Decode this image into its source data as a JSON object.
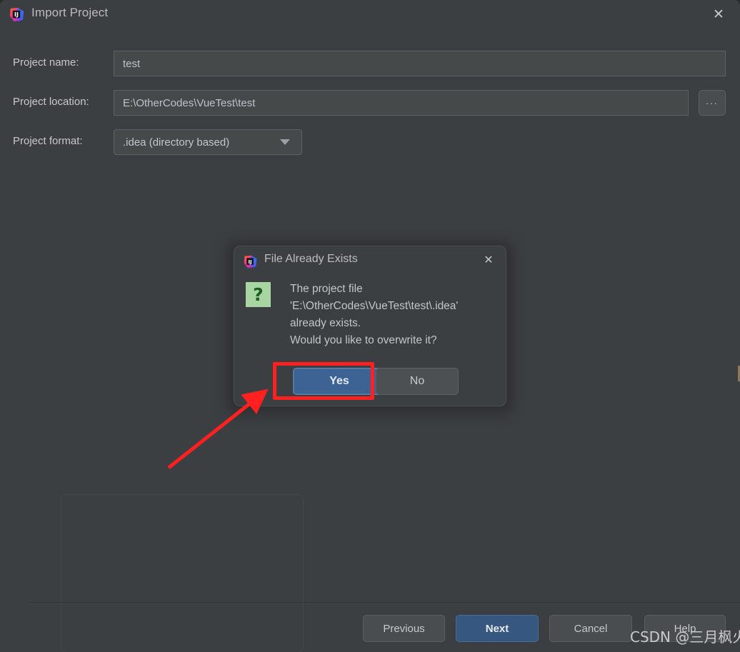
{
  "window": {
    "title": "Import Project",
    "logo_icon": "intellij-idea-logo",
    "close_icon": "close-icon"
  },
  "form": {
    "rows": [
      {
        "label": "Project name:",
        "value": "test"
      },
      {
        "label": "Project location:",
        "value": "E:\\OtherCodes\\VueTest\\test"
      },
      {
        "label": "Project format:",
        "value": ".idea (directory based)"
      }
    ],
    "browse_icon": "ellipsis-icon",
    "browse_label": "...",
    "caret_icon": "chevron-down-icon"
  },
  "footer": {
    "buttons": [
      {
        "label": "Previous",
        "primary": false
      },
      {
        "label": "Next",
        "primary": true
      },
      {
        "label": "Cancel",
        "primary": false
      },
      {
        "label": "Help",
        "primary": false
      }
    ]
  },
  "dialog": {
    "title": "File Already Exists",
    "logo_icon": "intellij-idea-logo",
    "close_icon": "close-icon",
    "question_icon": "question-mark-icon",
    "question_glyph": "?",
    "message": "The project file\n'E:\\OtherCodes\\VueTest\\test\\.idea'\nalready exists.\nWould you like to overwrite it?",
    "buttons": {
      "yes": "Yes",
      "no": "No"
    }
  },
  "annotations": {
    "highlight_color": "#ff2020",
    "arrow_color": "#ff2020",
    "watermark": "CSDN @三月枫火"
  },
  "colors": {
    "window_bg": "#3c3f41",
    "field_bg": "#45494a",
    "primary_button": "#365880",
    "dialog_yes_button": "#3c6394",
    "question_icon_bg": "#a8d5a2",
    "text": "#c9c9c9"
  }
}
